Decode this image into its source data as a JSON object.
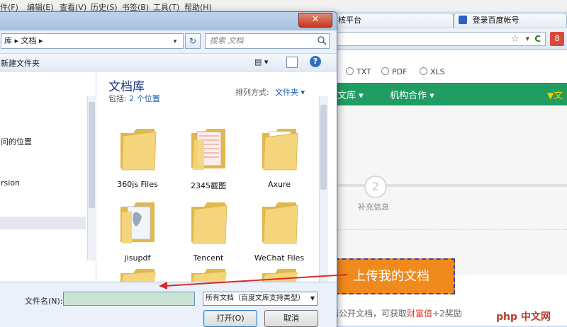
{
  "browser": {
    "menu": [
      "件(F)",
      "编辑(E)",
      "查看(V)",
      "历史(S)",
      "书签(B)",
      "工具(T)",
      "帮助(H)"
    ],
    "tabs": [
      {
        "label": "核平台"
      },
      {
        "label": "登录百度帐号"
      }
    ],
    "toolbar": {
      "star": "☆",
      "dropdown": "▾",
      "refresh": "C",
      "profile": "8"
    },
    "formats": [
      "TXT",
      "PDF",
      "XLS"
    ],
    "nav": [
      {
        "label": "文库 ▾"
      },
      {
        "label": "机构合作 ▾"
      },
      {
        "label": "文"
      }
    ],
    "step": {
      "number": "2",
      "label": "补充信息"
    },
    "upload_button": "上传我的文档",
    "hint": {
      "pre": "篇公开文档，可获取",
      "red": "财富值",
      "post": "+2奖励"
    },
    "watermark": "php 中文网"
  },
  "dialog": {
    "close": "✕",
    "address": {
      "crumbs": "库  ▸  文档  ▸"
    },
    "search_placeholder": "搜索 文档",
    "cmdbar": {
      "new_folder": "新建文件夹",
      "view": "▤  ▾",
      "help": "?"
    },
    "nav_items": [
      {
        "label": "问的位置"
      },
      {
        "label": "rsion"
      }
    ],
    "library": {
      "title": "文档库",
      "includes_label": "包括:",
      "includes_value": "2 个位置",
      "sort_label": "排列方式:",
      "sort_value": "文件夹 ▾"
    },
    "files": [
      {
        "name": "360js Files"
      },
      {
        "name": "2345截图"
      },
      {
        "name": "Axure"
      },
      {
        "name": "jisupdf"
      },
      {
        "name": "Tencent"
      },
      {
        "name": "WeChat Files"
      }
    ],
    "filename_label": "文件名(N):",
    "filename_value": "",
    "filetype": "所有文档（百度文库支持类型）",
    "open_button": "打开(O)",
    "cancel_button": "取消"
  },
  "colors": {
    "green_nav": "#1f9d62",
    "upload": "#f08a1c",
    "annotation": "#d92b2b",
    "link": "#1a5fb4"
  }
}
